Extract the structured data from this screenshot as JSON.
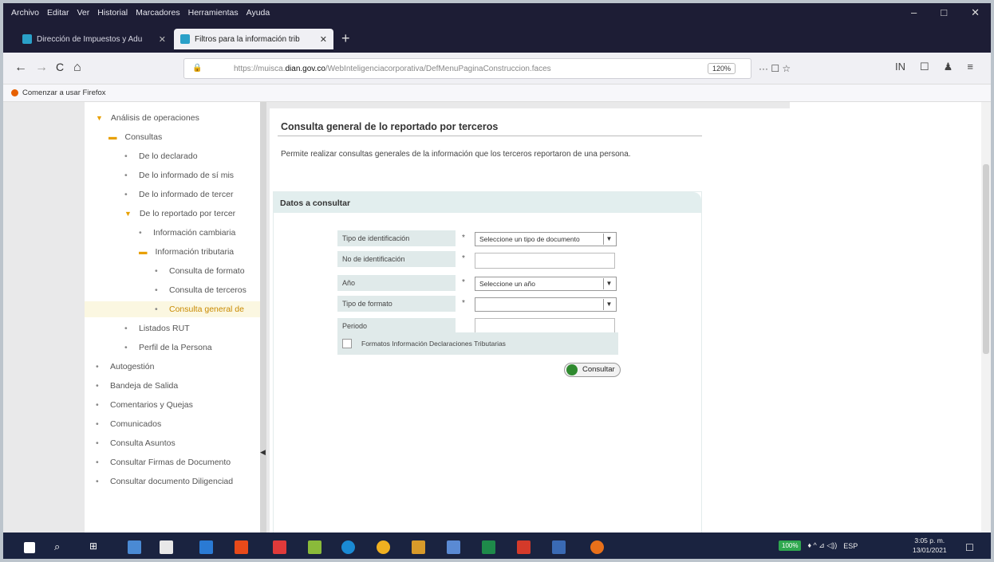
{
  "window": {
    "menu": [
      "Archivo",
      "Editar",
      "Ver",
      "Historial",
      "Marcadores",
      "Herramientas",
      "Ayuda"
    ],
    "controls": {
      "minimize": "–",
      "maximize": "□",
      "close": "✕"
    }
  },
  "tabs": [
    {
      "label": "Dirección de Impuestos y Adu",
      "close": "✕"
    },
    {
      "label": "Filtros para la información trib",
      "close": "✕"
    }
  ],
  "newtab": "+",
  "nav": {
    "back": "←",
    "forward": "→",
    "reload": "C",
    "home": "⌂",
    "url_prefix": "https://muisca.",
    "url_domain": "dian.gov.co",
    "url_path": "/WebInteligenciacorporativa/DefMenuPaginaConstruccion.faces",
    "zoom": "120%",
    "page_actions": "··· ☐ ☆"
  },
  "toolbar_right": [
    "IN",
    "☐",
    "♟",
    "≡"
  ],
  "bookmarks": {
    "label": "Comenzar a usar Firefox"
  },
  "sidebar": [
    {
      "label": "Análisis de operaciones",
      "kind": "tri"
    },
    {
      "label": "Consultas",
      "kind": "folder"
    },
    {
      "label": "De lo declarado",
      "kind": "bullet"
    },
    {
      "label": "De lo informado de sí mis",
      "kind": "bullet"
    },
    {
      "label": "De lo informado de tercer",
      "kind": "bullet"
    },
    {
      "label": "De lo reportado por tercer",
      "kind": "tri"
    },
    {
      "label": "Información cambiaria",
      "kind": "bullet"
    },
    {
      "label": "Información tributaria",
      "kind": "folder"
    },
    {
      "label": "Consulta de formato",
      "kind": "bullet"
    },
    {
      "label": "Consulta de terceros",
      "kind": "bullet"
    },
    {
      "label": "Consulta general de",
      "kind": "bullet",
      "active": true
    },
    {
      "label": "Listados RUT",
      "kind": "bullet"
    },
    {
      "label": "Perfil de la Persona",
      "kind": "bullet"
    },
    {
      "label": "Autogestión",
      "kind": "bullet"
    },
    {
      "label": "Bandeja de Salida",
      "kind": "bullet"
    },
    {
      "label": "Comentarios y Quejas",
      "kind": "bullet"
    },
    {
      "label": "Comunicados",
      "kind": "bullet"
    },
    {
      "label": "Consulta Asuntos",
      "kind": "bullet"
    },
    {
      "label": "Consultar Firmas de Documento",
      "kind": "bullet"
    },
    {
      "label": "Consultar documento Diligenciad",
      "kind": "bullet"
    }
  ],
  "main": {
    "title": "Consulta general de lo reportado por terceros",
    "description": "Permite realizar consultas generales de la información que los terceros reportaron de una persona.",
    "panel_title": "Datos a consultar",
    "fields": [
      {
        "label": "Tipo de identificación",
        "required": "*",
        "type": "select",
        "value": "Seleccione un tipo de documento"
      },
      {
        "label": "No de identificación",
        "required": "*",
        "type": "text",
        "value": ""
      },
      {
        "label": "Año",
        "required": "*",
        "type": "select",
        "value": "Seleccione un año"
      },
      {
        "label": "Tipo de formato",
        "required": "*",
        "type": "select",
        "value": ""
      },
      {
        "label": "Periodo",
        "required": "",
        "type": "text",
        "value": ""
      }
    ],
    "checkbox_label": "Formatos Información Declaraciones Tributarias",
    "submit_label": "Consultar"
  },
  "taskbar": {
    "battery": "100%",
    "tray_icons": "♦ ^ ⊿ ◁))",
    "lang": "ESP",
    "time": "3:05 p. m.",
    "date": "13/01/2021",
    "notification": "☐"
  },
  "colors": {
    "titlebar": "#1d1d35",
    "taskbar": "#1a2340",
    "panel": "#e2eeee",
    "accent": "#e8a000"
  }
}
